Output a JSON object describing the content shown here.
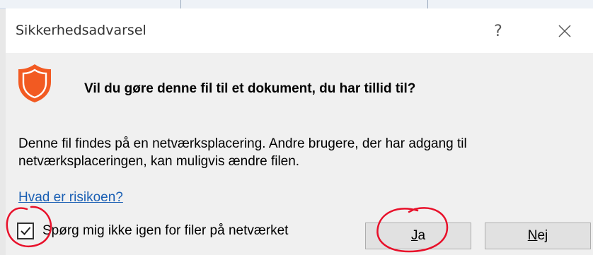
{
  "dialog": {
    "title": "Sikkerhedsadvarsel",
    "help_glyph": "?",
    "question": "Vil du gøre denne fil til et dokument, du har tillid til?",
    "body_line1": "Denne fil findes på en netværksplacering. Andre brugere, der har adgang til",
    "body_line2": "netværksplaceringen, kan muligvis ændre filen.",
    "link_text": "Hvad er risikoen?",
    "checkbox": {
      "label": "Spørg mig ikke igen for filer på netværket",
      "checked": true
    },
    "buttons": {
      "yes_accel": "J",
      "yes_rest": "a",
      "no_accel": "N",
      "no_rest": "ej"
    }
  },
  "colors": {
    "shield": "#f25a22",
    "link": "#1a5fb4",
    "annotation": "#e8102a"
  },
  "icons": {
    "shield": "shield-icon",
    "help": "help-icon",
    "close": "close-icon",
    "check": "checkmark-icon"
  }
}
